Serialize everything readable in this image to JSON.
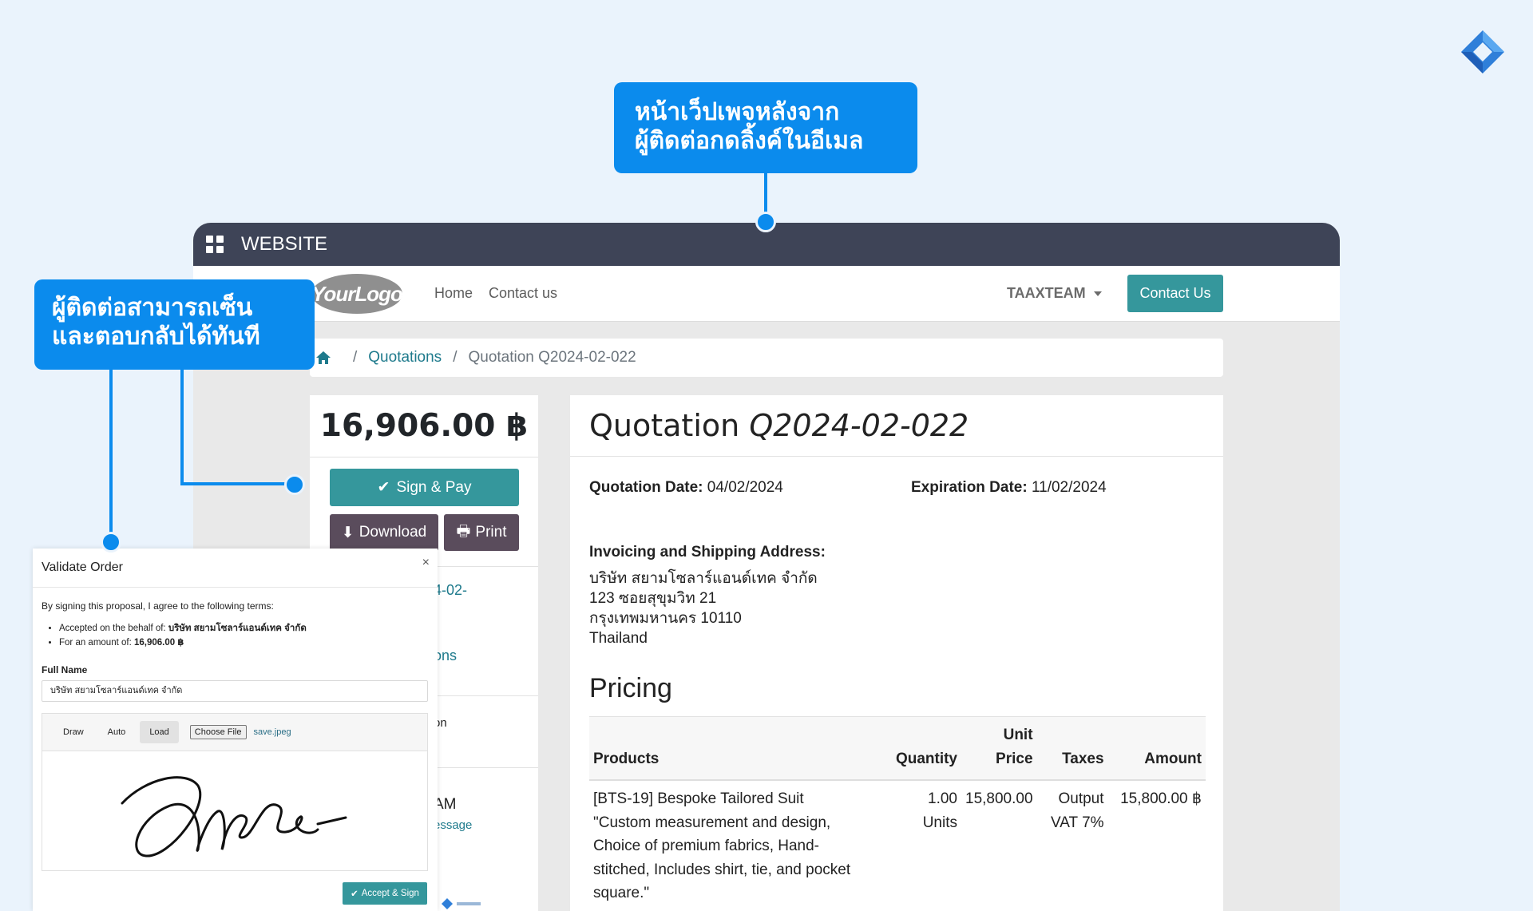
{
  "callouts": {
    "top": "หน้าเว็ปเพจหลังจาก\nผู้ติดต่อกดลิ้งค์ในอีเมล",
    "left": "ผู้ติดต่อสามารถเซ็น\nและตอบกลับได้ทันที"
  },
  "window": {
    "title": "WEBSITE"
  },
  "nav": {
    "logo": "YourLogo",
    "home": "Home",
    "contact": "Contact us",
    "user": "TAAXTEAM",
    "contact_button": "Contact Us"
  },
  "breadcrumb": {
    "quotations": "Quotations",
    "current": "Quotation Q2024-02-022"
  },
  "sidebar": {
    "total": "16,906.00 ฿",
    "sign_pay": "Sign & Pay",
    "download": "Download",
    "print": "Print",
    "fragments": [
      "4-02-",
      "ons",
      "on",
      "AM",
      "essage"
    ]
  },
  "quotation": {
    "title_prefix": "Quotation",
    "title_number": "Q2024-02-022",
    "quotation_date_label": "Quotation Date:",
    "quotation_date": "04/02/2024",
    "expiration_date_label": "Expiration Date:",
    "expiration_date": "11/02/2024",
    "address_label": "Invoicing and Shipping Address:",
    "address_lines": [
      "บริษัท สยามโซลาร์แอนด์เทค จำกัด",
      "123 ซอยสุขุมวิท 21",
      "กรุงเทพมหานคร 10110",
      "Thailand"
    ],
    "pricing_title": "Pricing",
    "table": {
      "headers": {
        "products": "Products",
        "quantity": "Quantity",
        "unit_price_1": "Unit",
        "unit_price_2": "Price",
        "taxes": "Taxes",
        "amount": "Amount"
      },
      "rows": [
        {
          "product_lines": [
            "[BTS-19] Bespoke Tailored Suit",
            "\"Custom measurement and design,",
            "Choice of premium fabrics, Hand-",
            "stitched, Includes shirt, tie, and pocket",
            "square.\""
          ],
          "quantity": "1.00",
          "unit": "Units",
          "unit_price": "15,800.00",
          "taxes_1": "Output",
          "taxes_2": "VAT 7%",
          "amount": "15,800.00 ฿"
        }
      ]
    }
  },
  "dialog": {
    "title": "Validate Order",
    "close": "×",
    "intro": "By signing this proposal, I agree to the following terms:",
    "term_1_label": "Accepted on the behalf of:",
    "term_1_value": "บริษัท สยามโซลาร์แอนด์เทค จำกัด",
    "term_2_label": "For an amount of:",
    "term_2_value": "16,906.00 ฿",
    "full_name_label": "Full Name",
    "full_name_value": "บริษัท สยามโซลาร์แอนด์เทค จำกัด",
    "tabs": [
      "Draw",
      "Auto",
      "Load"
    ],
    "choose_file": "Choose File",
    "file_name": "save.jpeg",
    "accept_button": "Accept & Sign"
  },
  "colors": {
    "accent": "#0b8bed",
    "primary_button": "#35979c",
    "dark_button": "#5a4c5c",
    "window_bar": "#3e4457",
    "background": "#eaf3fc"
  }
}
